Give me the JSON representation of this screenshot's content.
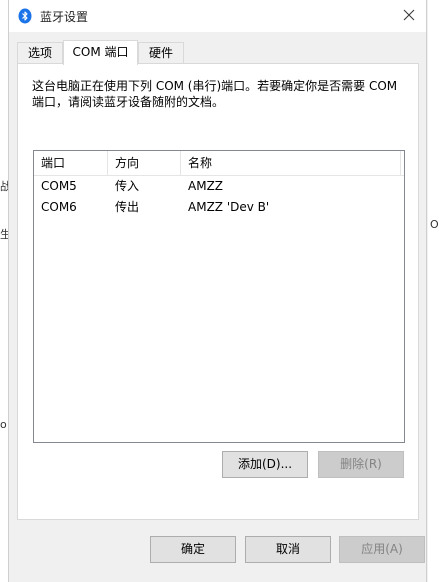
{
  "window": {
    "title": "蓝牙设置",
    "close_glyph": "✕"
  },
  "background": {
    "left_fragments": [
      "战",
      "生",
      "o"
    ],
    "right_fragments": [
      "O"
    ]
  },
  "tabs": [
    {
      "label": "选项",
      "active": false
    },
    {
      "label": "COM 端口",
      "active": true
    },
    {
      "label": "硬件",
      "active": false
    }
  ],
  "com_panel": {
    "description_line1": "这台电脑正在使用下列 COM (串行)端口。若要确定你是否需要 COM",
    "description_line2": "端口，请阅读蓝牙设备随附的文档。",
    "columns": [
      "端口",
      "方向",
      "名称"
    ],
    "rows": [
      {
        "port": "COM5",
        "direction": "传入",
        "name": "AMZZ"
      },
      {
        "port": "COM6",
        "direction": "传出",
        "name": "AMZZ 'Dev B'"
      }
    ],
    "add_label": "添加(D)...",
    "remove_label": "删除(R)"
  },
  "footer": {
    "ok_label": "确定",
    "cancel_label": "取消",
    "apply_label": "应用(A)"
  },
  "colors": {
    "bluetooth_icon": "#1a73e8",
    "list_border": "#828790",
    "button_face": "#e1e1e1"
  }
}
